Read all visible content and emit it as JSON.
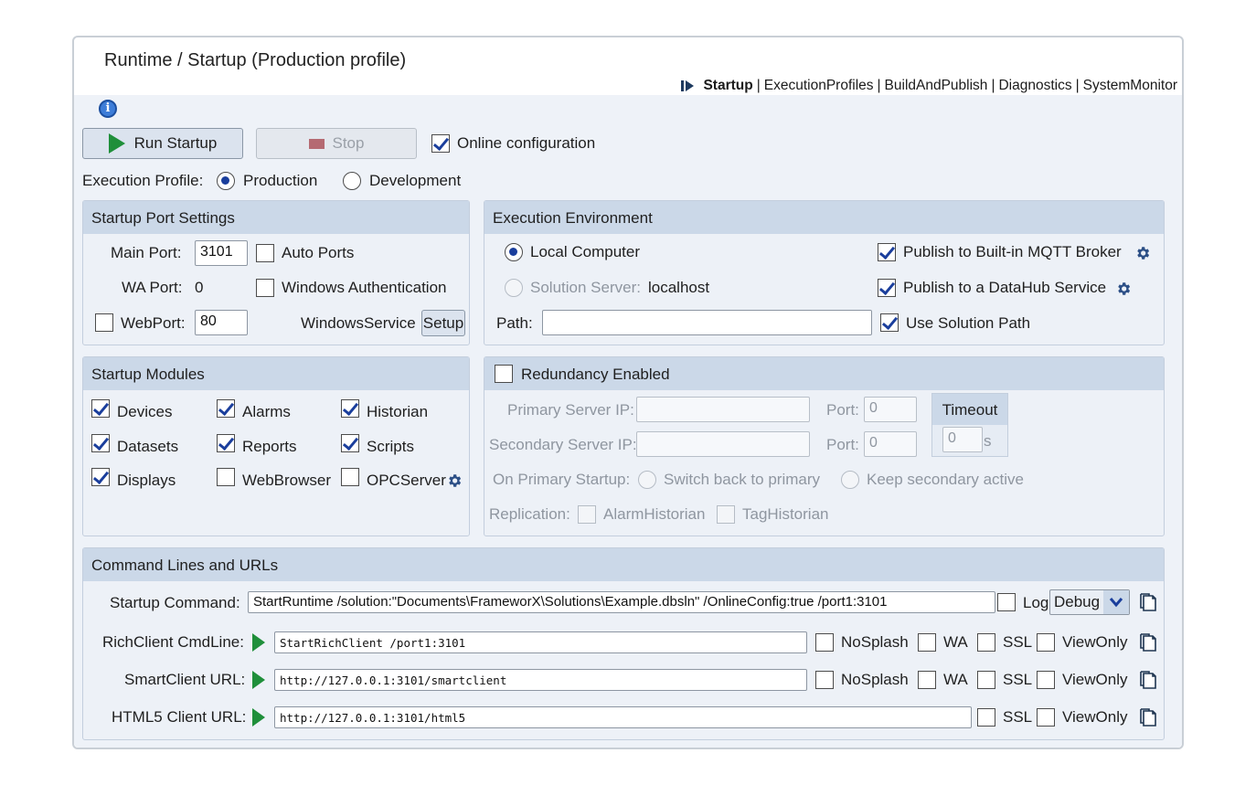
{
  "header": {
    "title": "Runtime / Startup (Production profile)",
    "breadcrumb": {
      "current": "Startup",
      "links": [
        "ExecutionProfiles",
        "BuildAndPublish",
        "Diagnostics",
        "SystemMonitor"
      ],
      "separator": "|"
    }
  },
  "toolbar": {
    "run_label": "Run Startup",
    "stop_label": "Stop",
    "online_config_label": "Online configuration",
    "online_config_checked": true
  },
  "execution_profile": {
    "label": "Execution Profile:",
    "options": [
      "Production",
      "Development"
    ],
    "selected": "Production"
  },
  "port_settings": {
    "title": "Startup Port Settings",
    "main_port_label": "Main Port:",
    "main_port_value": "3101",
    "auto_ports_label": "Auto Ports",
    "wa_port_label": "WA Port:",
    "wa_port_value": "0",
    "windows_auth_label": "Windows Authentication",
    "webport_label": "WebPort:",
    "webport_value": "80",
    "windows_service_label": "WindowsService",
    "setup_label": "Setup"
  },
  "execution_environment": {
    "title": "Execution Environment",
    "local_label": "Local Computer",
    "server_label": "Solution Server:",
    "server_value": "localhost",
    "mqtt_label": "Publish to Built-in MQTT Broker",
    "datahub_label": "Publish to a DataHub Service",
    "path_label": "Path:",
    "path_value": "",
    "use_solution_path_label": "Use Solution Path"
  },
  "startup_modules": {
    "title": "Startup Modules",
    "items": [
      {
        "label": "Devices",
        "checked": true
      },
      {
        "label": "Alarms",
        "checked": true
      },
      {
        "label": "Historian",
        "checked": true
      },
      {
        "label": "Datasets",
        "checked": true
      },
      {
        "label": "Reports",
        "checked": true
      },
      {
        "label": "Scripts",
        "checked": true
      },
      {
        "label": "Displays",
        "checked": true
      },
      {
        "label": "WebBrowser",
        "checked": false
      },
      {
        "label": "OPCServer",
        "checked": false
      }
    ]
  },
  "redundancy": {
    "title": "Redundancy Enabled",
    "primary_ip_label": "Primary Server IP:",
    "secondary_ip_label": "Secondary Server IP:",
    "port_label": "Port:",
    "primary_port_value": "0",
    "secondary_port_value": "0",
    "timeout_label": "Timeout",
    "timeout_value": "0",
    "timeout_unit": "s",
    "on_primary_label": "On Primary Startup:",
    "switch_back_label": "Switch back to primary",
    "keep_secondary_label": "Keep secondary active",
    "replication_label": "Replication:",
    "alarm_historian_label": "AlarmHistorian",
    "tag_historian_label": "TagHistorian"
  },
  "command_lines": {
    "title": "Command Lines and URLs",
    "startup_label": "Startup Command:",
    "startup_value": "StartRuntime /solution:\"Documents\\FrameworX\\Solutions\\Example.dbsln\" /OnlineConfig:true /port1:3101",
    "log_label": "Log",
    "log_level": "Debug",
    "richclient_label": "RichClient CmdLine:",
    "richclient_value": "StartRichClient  /port1:3101",
    "smartclient_label": "SmartClient URL:",
    "smartclient_value": "http://127.0.0.1:3101/smartclient",
    "html5_label": "HTML5 Client URL:",
    "html5_value": "http://127.0.0.1:3101/html5",
    "nosplash_label": "NoSplash",
    "wa_label": "WA",
    "ssl_label": "SSL",
    "viewonly_label": "ViewOnly"
  },
  "icons": {
    "info": "info-icon",
    "gear": "gear-icon",
    "copy": "copy-icon",
    "run": "play-icon",
    "stop": "stop-icon"
  },
  "colors": {
    "accent": "#1a3e9c",
    "run_green": "#1f8f3a",
    "panel_header": "#cbd8e8",
    "content_bg": "#eef2f8"
  }
}
